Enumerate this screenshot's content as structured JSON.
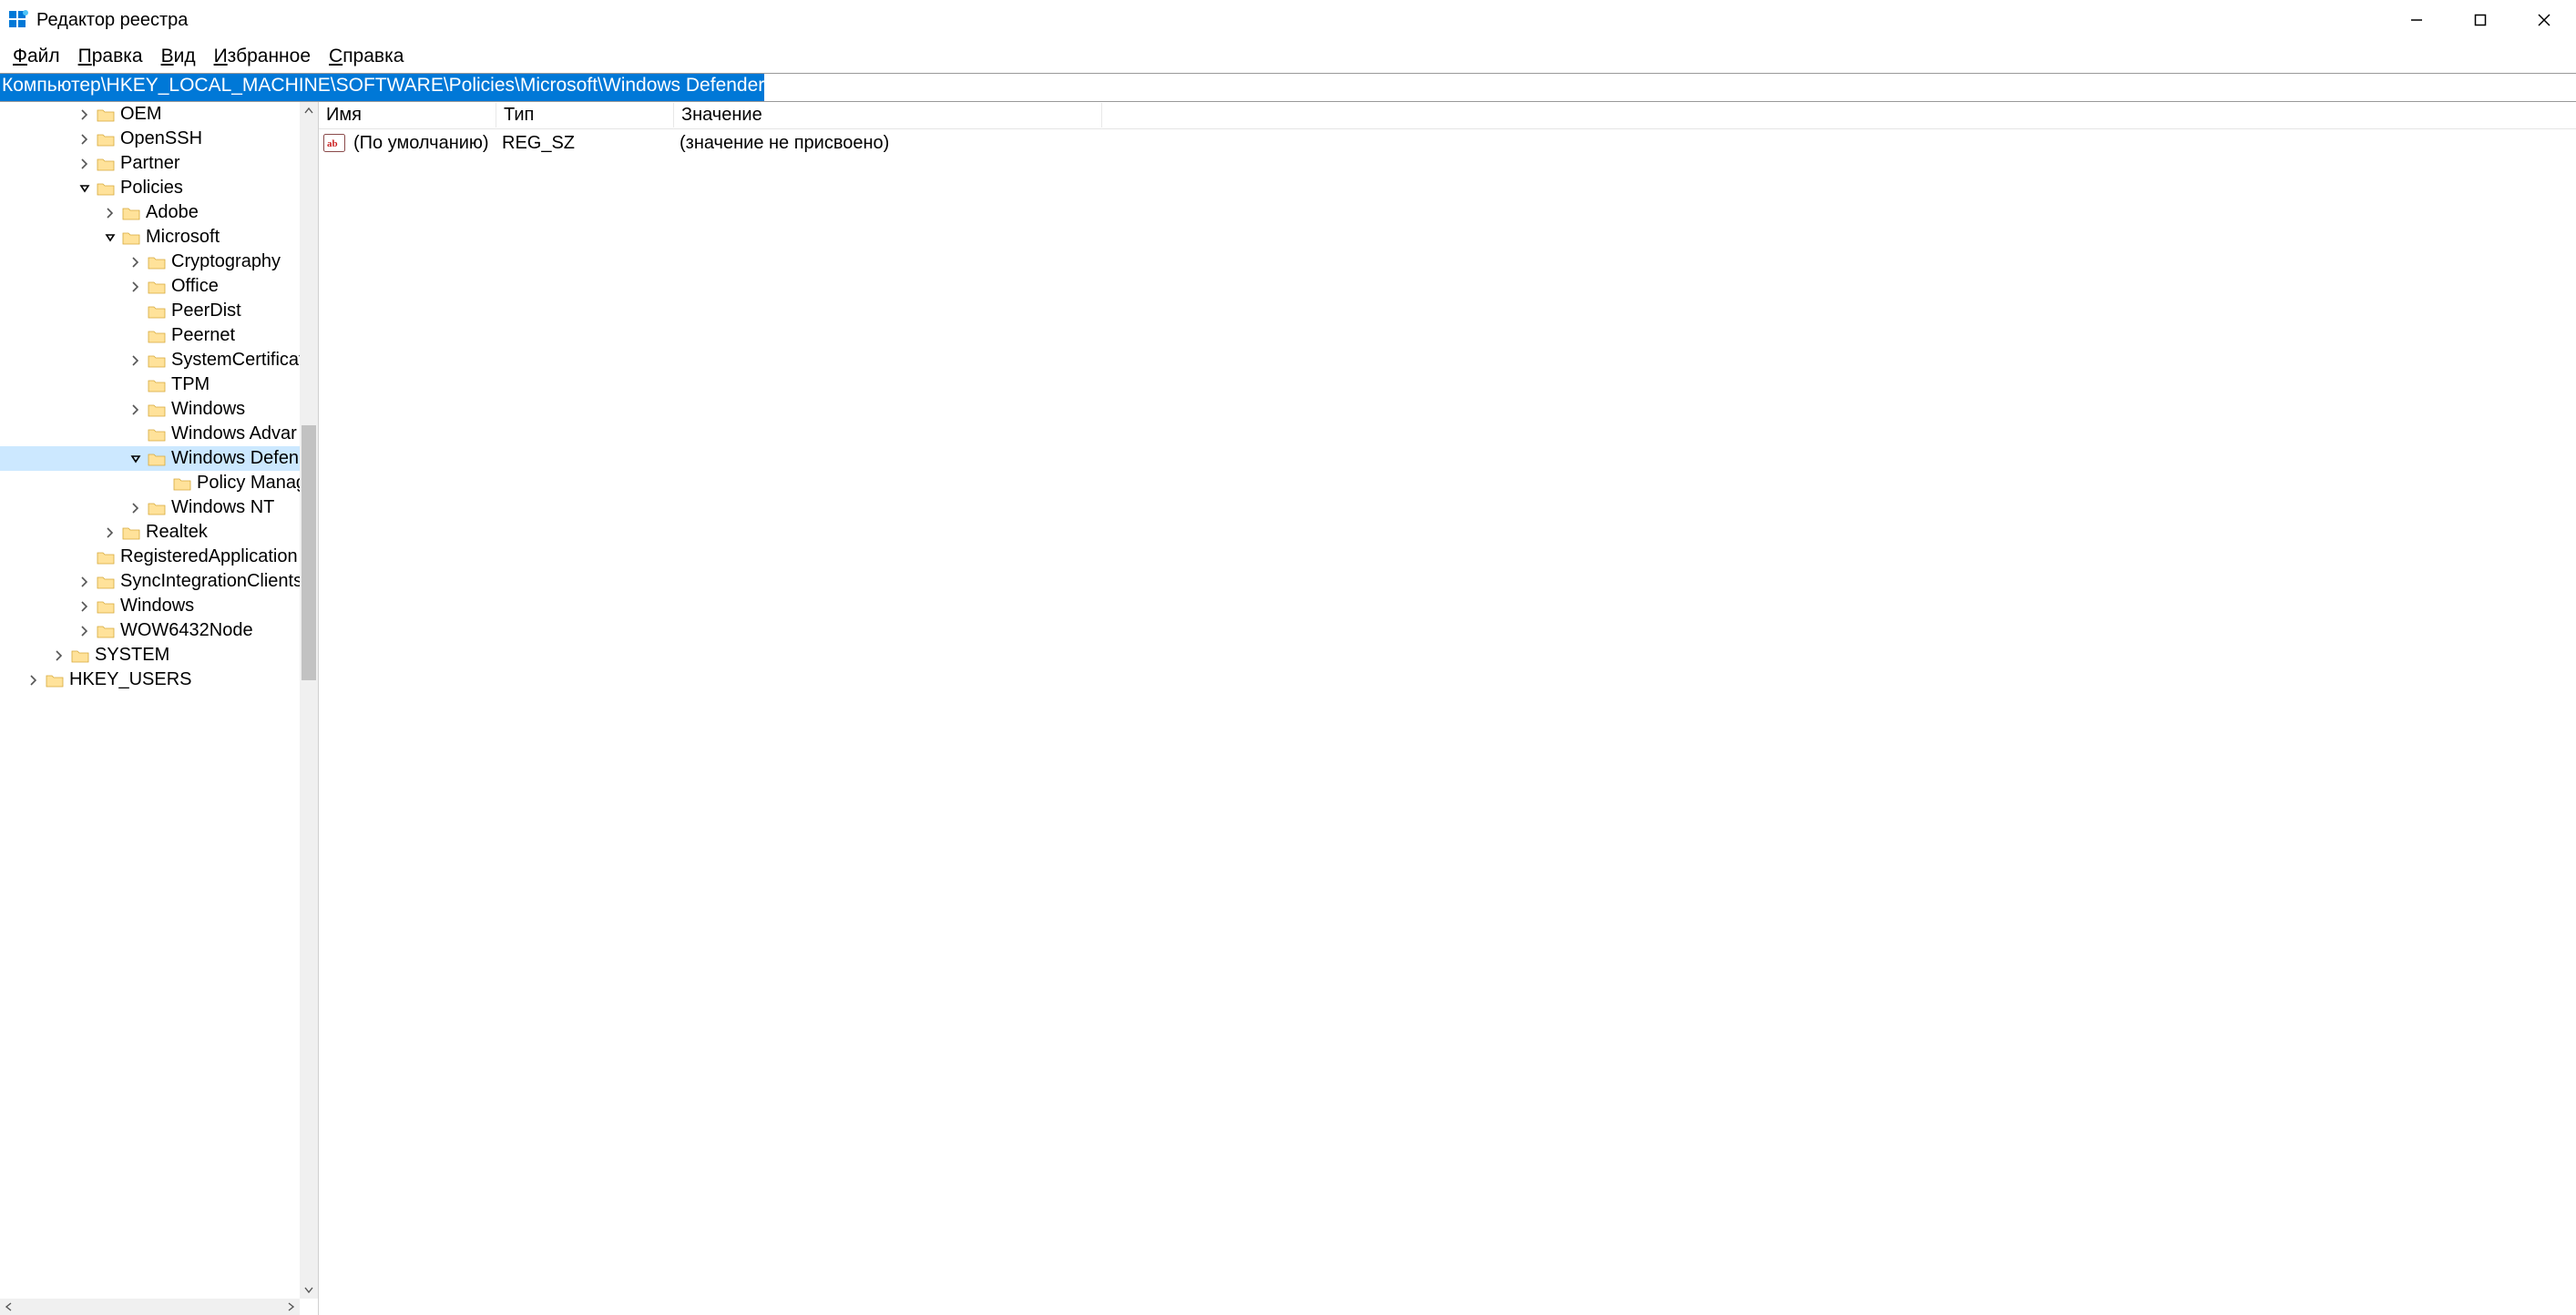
{
  "window": {
    "title": "Редактор реестра"
  },
  "menu": {
    "file": "Файл",
    "edit": "Правка",
    "view": "Вид",
    "favorites": "Избранное",
    "help": "Справка"
  },
  "address": {
    "path": "Компьютер\\HKEY_LOCAL_MACHINE\\SOFTWARE\\Policies\\Microsoft\\Windows Defender"
  },
  "tree": [
    {
      "label": "OEM",
      "level": 3,
      "chev": "right"
    },
    {
      "label": "OpenSSH",
      "level": 3,
      "chev": "right"
    },
    {
      "label": "Partner",
      "level": 3,
      "chev": "right"
    },
    {
      "label": "Policies",
      "level": 3,
      "chev": "down"
    },
    {
      "label": "Adobe",
      "level": 4,
      "chev": "right"
    },
    {
      "label": "Microsoft",
      "level": 4,
      "chev": "down"
    },
    {
      "label": "Cryptography",
      "level": 5,
      "chev": "right"
    },
    {
      "label": "Office",
      "level": 5,
      "chev": "right"
    },
    {
      "label": "PeerDist",
      "level": 5,
      "chev": "blank"
    },
    {
      "label": "Peernet",
      "level": 5,
      "chev": "blank"
    },
    {
      "label": "SystemCertificat",
      "level": 5,
      "chev": "right"
    },
    {
      "label": "TPM",
      "level": 5,
      "chev": "blank"
    },
    {
      "label": "Windows",
      "level": 5,
      "chev": "right"
    },
    {
      "label": "Windows Advar",
      "level": 5,
      "chev": "blank"
    },
    {
      "label": "Windows Defen",
      "level": 5,
      "chev": "down",
      "selected": true
    },
    {
      "label": "Policy Manag",
      "level": 6,
      "chev": "blank"
    },
    {
      "label": "Windows NT",
      "level": 5,
      "chev": "right"
    },
    {
      "label": "Realtek",
      "level": 4,
      "chev": "right"
    },
    {
      "label": "RegisteredApplication",
      "level": 3,
      "chev": "blank"
    },
    {
      "label": "SyncIntegrationClients",
      "level": 3,
      "chev": "right"
    },
    {
      "label": "Windows",
      "level": 3,
      "chev": "right"
    },
    {
      "label": "WOW6432Node",
      "level": 3,
      "chev": "right"
    },
    {
      "label": "SYSTEM",
      "level": 2,
      "chev": "right"
    },
    {
      "label": "HKEY_USERS",
      "level": 1,
      "chev": "right"
    }
  ],
  "columns": {
    "name": "Имя",
    "type": "Тип",
    "value": "Значение"
  },
  "values": [
    {
      "name": "(По умолчанию)",
      "type": "REG_SZ",
      "value": "(значение не присвоено)"
    }
  ]
}
